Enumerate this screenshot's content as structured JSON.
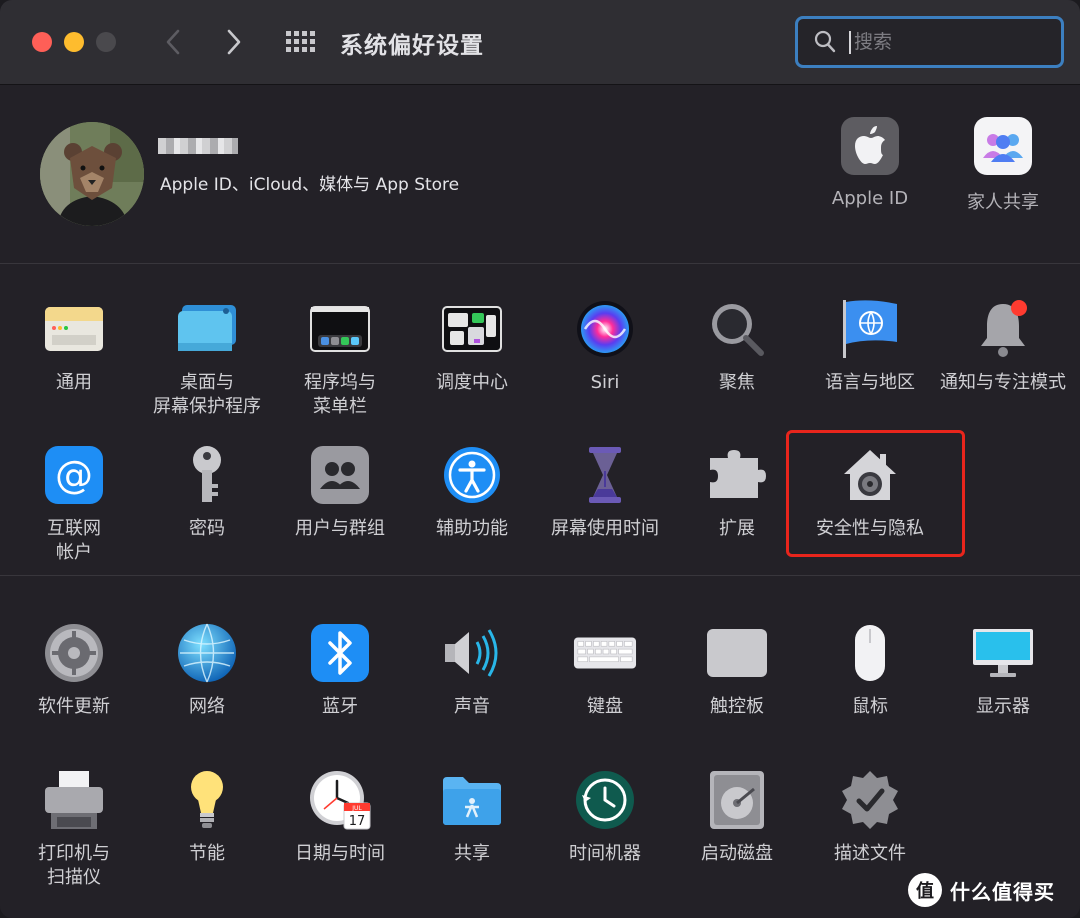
{
  "window": {
    "title": "系统偏好设置",
    "search_placeholder": "搜索"
  },
  "account": {
    "subtitle": "Apple ID、iCloud、媒体与 App Store",
    "apple_id_label": "Apple ID",
    "family_label": "家人共享"
  },
  "section1": [
    {
      "label": "通用",
      "icon": "general-icon"
    },
    {
      "label": "桌面与\n屏幕保护程序",
      "icon": "desktop-icon"
    },
    {
      "label": "程序坞与\n菜单栏",
      "icon": "dock-icon"
    },
    {
      "label": "调度中心",
      "icon": "mission-control-icon"
    },
    {
      "label": "Siri",
      "icon": "siri-icon"
    },
    {
      "label": "聚焦",
      "icon": "spotlight-icon"
    },
    {
      "label": "语言与地区",
      "icon": "language-region-icon"
    },
    {
      "label": "通知与专注模式",
      "icon": "notifications-icon"
    },
    {
      "label": "互联网\n帐户",
      "icon": "internet-accounts-icon"
    },
    {
      "label": "密码",
      "icon": "passwords-icon"
    },
    {
      "label": "用户与群组",
      "icon": "users-groups-icon"
    },
    {
      "label": "辅助功能",
      "icon": "accessibility-icon"
    },
    {
      "label": "屏幕使用时间",
      "icon": "screen-time-icon"
    },
    {
      "label": "扩展",
      "icon": "extensions-icon"
    },
    {
      "label": "安全性与隐私",
      "icon": "security-privacy-icon"
    }
  ],
  "section2": [
    {
      "label": "软件更新",
      "icon": "software-update-icon"
    },
    {
      "label": "网络",
      "icon": "network-icon"
    },
    {
      "label": "蓝牙",
      "icon": "bluetooth-icon"
    },
    {
      "label": "声音",
      "icon": "sound-icon"
    },
    {
      "label": "键盘",
      "icon": "keyboard-icon"
    },
    {
      "label": "触控板",
      "icon": "trackpad-icon"
    },
    {
      "label": "鼠标",
      "icon": "mouse-icon"
    },
    {
      "label": "显示器",
      "icon": "displays-icon"
    },
    {
      "label": "打印机与\n扫描仪",
      "icon": "printers-icon"
    },
    {
      "label": "节能",
      "icon": "energy-saver-icon"
    },
    {
      "label": "日期与时间",
      "icon": "date-time-icon"
    },
    {
      "label": "共享",
      "icon": "sharing-icon"
    },
    {
      "label": "时间机器",
      "icon": "time-machine-icon"
    },
    {
      "label": "启动磁盘",
      "icon": "startup-disk-icon"
    },
    {
      "label": "描述文件",
      "icon": "profiles-icon"
    }
  ],
  "calendar": {
    "month": "JUL",
    "day": "17"
  },
  "watermark": {
    "logo": "值",
    "text": "什么值得买"
  },
  "colors": {
    "highlight": "#e8251c",
    "search_border": "#3c7fc0"
  }
}
